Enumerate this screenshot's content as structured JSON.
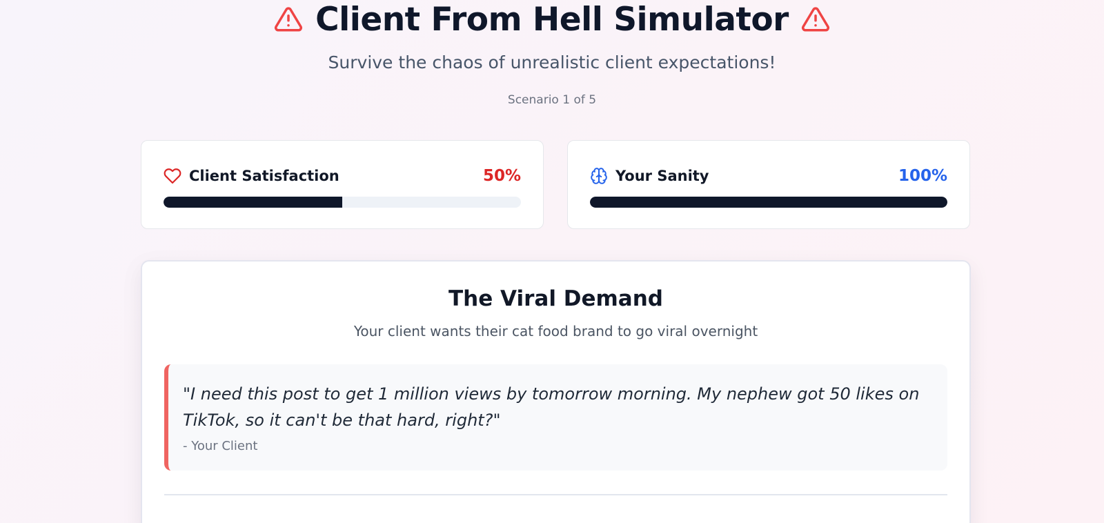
{
  "header": {
    "title": "Client From Hell Simulator",
    "subtitle": "Survive the chaos of unrealistic client expectations!",
    "scenario_label": "Scenario 1 of 5",
    "title_icon": "warning-triangle-icon",
    "accent_color": "#ef4444"
  },
  "meters": {
    "satisfaction": {
      "label": "Client Satisfaction",
      "value_text": "50%",
      "value": 50,
      "icon": "heart-icon",
      "color": "#dc2626"
    },
    "sanity": {
      "label": "Your Sanity",
      "value_text": "100%",
      "value": 100,
      "icon": "brain-icon",
      "color": "#2563eb"
    }
  },
  "scenario": {
    "title": "The Viral Demand",
    "description": "Your client wants their cat food brand to go viral overnight",
    "quote": "\"I need this post to get 1 million views by tomorrow morning. My nephew got 50 likes on TikTok, so it can't be that hard, right?\"",
    "quote_author": "- Your Client",
    "quote_border_color": "#ef6461"
  }
}
